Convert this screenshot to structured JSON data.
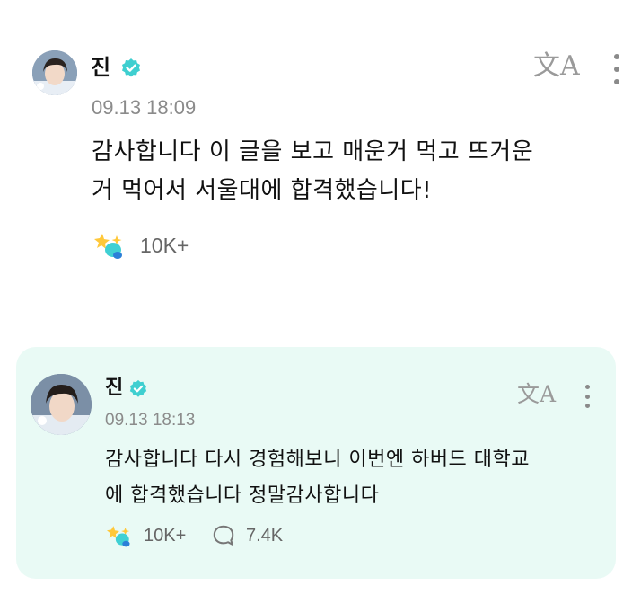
{
  "colors": {
    "accent_teal": "#2fd3c6",
    "verified_badge": "#3fcfd0",
    "highlight_bg": "#e9faf5",
    "muted_text": "#8b8b8b"
  },
  "posts": [
    {
      "author": "진",
      "verified_icon": "verified-badge-icon",
      "timestamp": "09.13 18:09",
      "translate_icon": "文A",
      "body_lines": [
        "감사합니다 이 글을 보고 매운거 먹고 뜨거운",
        "거 먹어서 서울대에 합격했습니다!"
      ],
      "reaction_icon": "cheer-sparkle-icon",
      "reaction_count": "10K+"
    },
    {
      "author": "진",
      "verified_icon": "verified-badge-icon",
      "timestamp": "09.13 18:13",
      "translate_icon": "文A",
      "body_lines": [
        "감사합니다 다시 경험해보니 이번엔 하버드 대학교",
        "에 합격했습니다 정말감사합니다"
      ],
      "reaction_icon": "cheer-sparkle-icon",
      "reaction_count": "10K+",
      "comment_icon": "comment-bubble-icon",
      "comment_count": "7.4K"
    }
  ]
}
